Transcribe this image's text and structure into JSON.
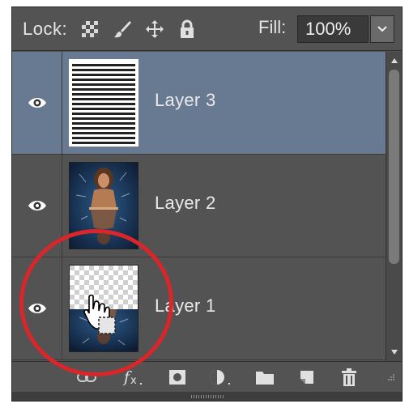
{
  "lock_bar": {
    "lock_label": "Lock:",
    "icons": [
      "lock-transparent-pixels-icon",
      "lock-image-pixels-icon",
      "lock-position-icon",
      "lock-all-icon"
    ],
    "fill_label": "Fill:",
    "fill_value": "100%"
  },
  "layers": [
    {
      "name": "Layer 3",
      "selected": true,
      "thumbnail": "horizontal-stripes"
    },
    {
      "name": "Layer 2",
      "selected": false,
      "thumbnail": "woman-photo"
    },
    {
      "name": "Layer 1",
      "selected": false,
      "thumbnail": "transparent-with-reflection"
    }
  ],
  "toolbar_icons": [
    "link-layers-icon",
    "layer-style-fx-icon",
    "layer-mask-icon",
    "adjustment-layer-icon",
    "new-group-icon",
    "new-layer-icon",
    "delete-layer-icon"
  ],
  "colors": {
    "panel_bg": "#535353",
    "selected_row": "#687a92",
    "highlight_circle": "#d8262a"
  }
}
